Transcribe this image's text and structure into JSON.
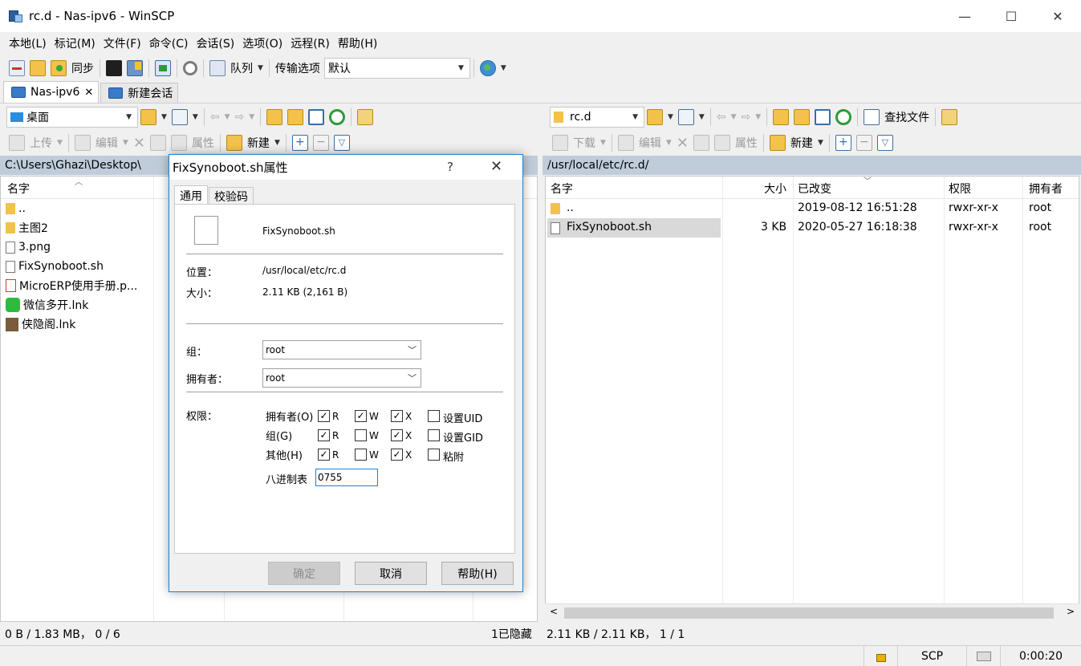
{
  "window": {
    "title": "rc.d - Nas-ipv6 - WinSCP",
    "minimize": "—",
    "maximize": "☐",
    "close": "✕"
  },
  "menu": [
    "本地(L)",
    "标记(M)",
    "文件(F)",
    "命令(C)",
    "会话(S)",
    "选项(O)",
    "远程(R)",
    "帮助(H)"
  ],
  "toolbar": {
    "sync": "同步",
    "queue": "队列",
    "transfer_options_label": "传输选项",
    "transfer_options_value": "默认"
  },
  "tabs": {
    "session": "Nas-ipv6",
    "new_session": "新建会话"
  },
  "local": {
    "location": "桌面",
    "upload": "上传",
    "edit": "编辑",
    "properties": "属性",
    "new": "新建",
    "path": "C:\\Users\\Ghazi\\Desktop\\",
    "col_name": "名字",
    "files": [
      "..",
      "主图2",
      "3.png",
      "FixSynoboot.sh",
      "MicroERP使用手册.p...",
      "微信多开.lnk",
      "侠隐阁.lnk"
    ],
    "status": "0 B / 1.83 MB， 0 / 6",
    "hidden": "1已隐藏"
  },
  "remote": {
    "location": "rc.d",
    "download": "下载",
    "edit": "编辑",
    "properties": "属性",
    "new": "新建",
    "find_files": "查找文件",
    "path": "/usr/local/etc/rc.d/",
    "columns": {
      "name": "名字",
      "size": "大小",
      "modified": "已改变",
      "rights": "权限",
      "owner": "拥有者"
    },
    "files": [
      {
        "name": "..",
        "size": "",
        "modified": "2019-08-12 16:51:28",
        "rights": "rwxr-xr-x",
        "owner": "root"
      },
      {
        "name": "FixSynoboot.sh",
        "size": "3 KB",
        "modified": "2020-05-27 16:18:38",
        "rights": "rwxr-xr-x",
        "owner": "root"
      }
    ],
    "status": "2.11 KB / 2.11 KB， 1 / 1"
  },
  "bottombar": {
    "protocol": "SCP",
    "time": "0:00:20"
  },
  "dialog": {
    "title": "FixSynoboot.sh属性",
    "help_icon": "?",
    "close": "✕",
    "tabs": [
      "通用",
      "校验码"
    ],
    "filename": "FixSynoboot.sh",
    "location_label": "位置：",
    "location": "/usr/local/etc/rc.d",
    "size_label": "大小：",
    "size": "2.11 KB (2,161 B)",
    "group_label": "组：",
    "group": "root",
    "owner_label": "拥有者：",
    "owner": "root",
    "perm_label": "权限：",
    "perm_rows": [
      {
        "label": "拥有者(O)",
        "r": true,
        "w": true,
        "x": true,
        "special": "设置UID"
      },
      {
        "label": "组(G)",
        "r": true,
        "w": false,
        "x": true,
        "special": "设置GID"
      },
      {
        "label": "其他(H)",
        "r": true,
        "w": false,
        "x": true,
        "special": "粘附"
      }
    ],
    "r": "R",
    "w": "W",
    "x": "X",
    "octal_label": "八进制表",
    "octal": "0755",
    "ok": "确定",
    "cancel": "取消",
    "help": "帮助(H)"
  }
}
